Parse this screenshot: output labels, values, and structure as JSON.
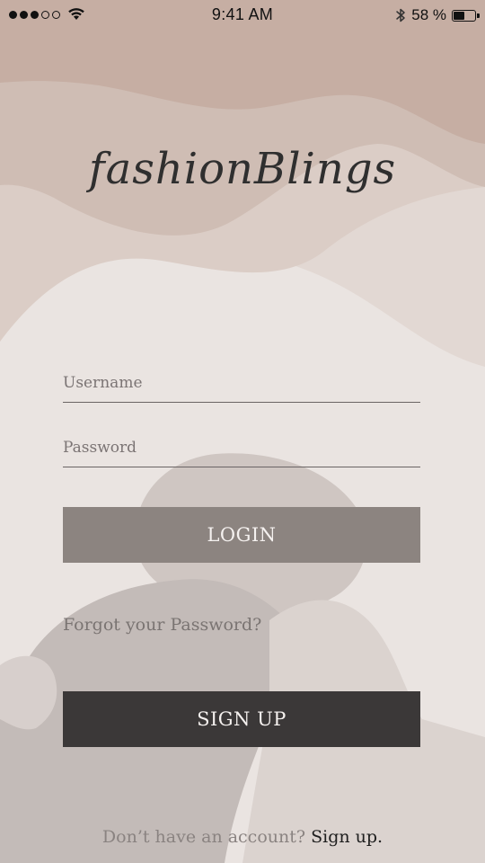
{
  "status_bar": {
    "signal_bars": 5,
    "signal_filled": 3,
    "time": "9:41 AM",
    "battery_percent_label": "58 %",
    "battery_level": 0.58,
    "wifi_icon": "wifi-icon",
    "bluetooth_icon": "bluetooth-icon"
  },
  "brand": {
    "logo_text": "fashionBlings"
  },
  "login_form": {
    "username_placeholder": "Username",
    "password_placeholder": "Password",
    "login_label": "LOGIN",
    "forgot_label": "Forgot your Password?",
    "signup_label": "SIGN UP"
  },
  "footer": {
    "prompt": "Don’t have an account?",
    "link": "Sign up",
    "trailing": "."
  },
  "colors": {
    "top_band": "#c6aea3",
    "background": "#eae4e1",
    "login_button": "#8c8480",
    "signup_button": "#3b3838",
    "text_dark": "#2f2f2f"
  }
}
